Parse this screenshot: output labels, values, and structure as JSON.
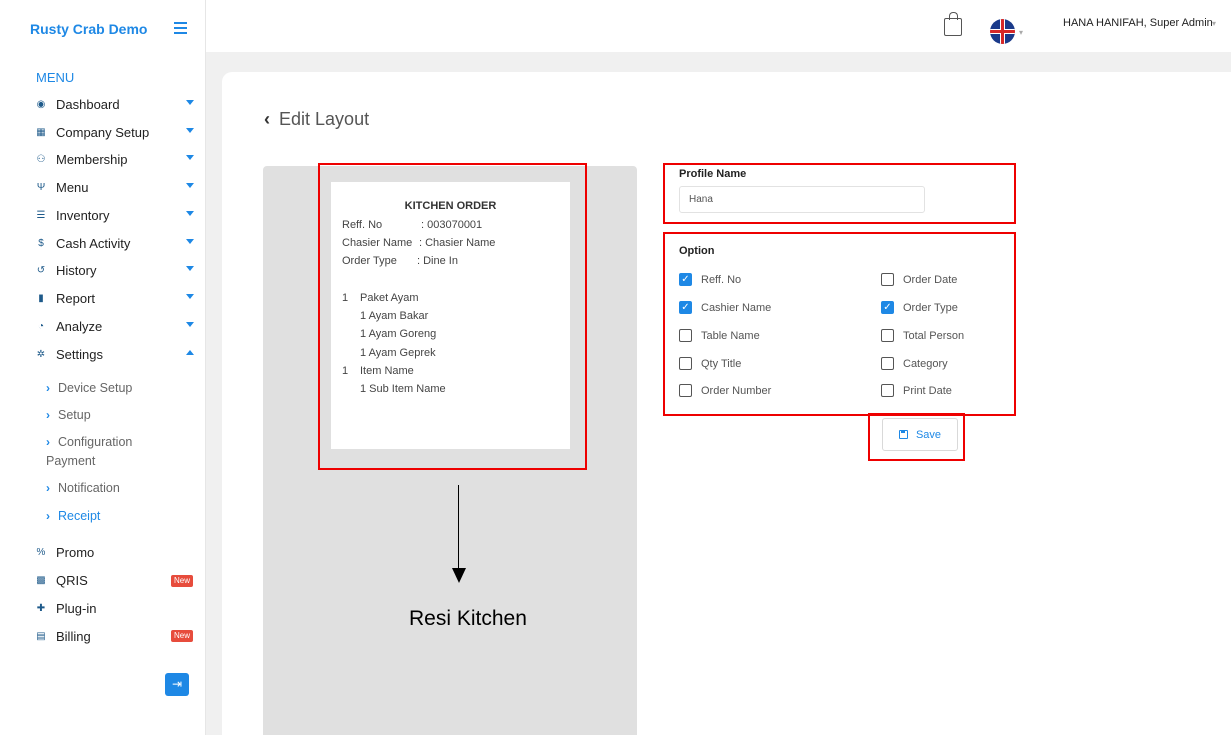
{
  "app": {
    "brand": "Rusty Crab Demo"
  },
  "sidebar": {
    "menu_heading": "MENU",
    "items": [
      {
        "label": "Dashboard",
        "icon": "dashboard-icon"
      },
      {
        "label": "Company Setup",
        "icon": "building-icon"
      },
      {
        "label": "Membership",
        "icon": "users-icon"
      },
      {
        "label": "Menu",
        "icon": "utensils-icon"
      },
      {
        "label": "Inventory",
        "icon": "list-icon"
      },
      {
        "label": "Cash Activity",
        "icon": "dollar-icon"
      },
      {
        "label": "History",
        "icon": "history-icon"
      },
      {
        "label": "Report",
        "icon": "file-icon"
      },
      {
        "label": "Analyze",
        "icon": "pie-chart-icon"
      },
      {
        "label": "Settings",
        "icon": "gear-icon"
      }
    ],
    "settings_sub": [
      "Device Setup",
      "Setup",
      "Configuration",
      "Payment",
      "Notification",
      "Receipt"
    ],
    "bottom_items": [
      {
        "label": "Promo",
        "icon": "percent-icon"
      },
      {
        "label": "QRIS",
        "icon": "qr-icon",
        "badge": "New"
      },
      {
        "label": "Plug-in",
        "icon": "puzzle-icon"
      },
      {
        "label": "Billing",
        "icon": "invoice-icon",
        "badge": "New"
      }
    ]
  },
  "topbar": {
    "user": "HANA HANIFAH, Super Admin"
  },
  "page": {
    "title": "Edit Layout"
  },
  "receipt": {
    "title": "KITCHEN ORDER",
    "reff_label": "Reff. No",
    "reff_value": ": 003070001",
    "cashier_label": "Chasier Name",
    "cashier_value": ": Chasier Name",
    "order_type_label": "Order Type",
    "order_type_value": ": Dine In",
    "lines": [
      {
        "qty": "1",
        "name": "Paket Ayam"
      },
      {
        "qty": "",
        "name": "1 Ayam Bakar"
      },
      {
        "qty": "",
        "name": "1 Ayam Goreng"
      },
      {
        "qty": "",
        "name": "1 Ayam Geprek"
      },
      {
        "qty": "1",
        "name": "Item Name"
      },
      {
        "qty": "",
        "name": "1 Sub Item Name"
      }
    ]
  },
  "annotation": {
    "label": "Resi Kitchen"
  },
  "form": {
    "profile_label": "Profile Name",
    "profile_value": "Hana",
    "option_label": "Option",
    "options": [
      {
        "label": "Reff. No",
        "checked": true
      },
      {
        "label": "Order Date",
        "checked": false
      },
      {
        "label": "Cashier Name",
        "checked": true
      },
      {
        "label": "Order Type",
        "checked": true
      },
      {
        "label": "Table Name",
        "checked": false
      },
      {
        "label": "Total Person",
        "checked": false
      },
      {
        "label": "Qty Title",
        "checked": false
      },
      {
        "label": "Category",
        "checked": false
      },
      {
        "label": "Order Number",
        "checked": false
      },
      {
        "label": "Print Date",
        "checked": false
      }
    ],
    "save_label": "Save"
  },
  "colors": {
    "accent": "#1e88e5",
    "highlight": "#e00000",
    "badge": "#e74c3c"
  }
}
